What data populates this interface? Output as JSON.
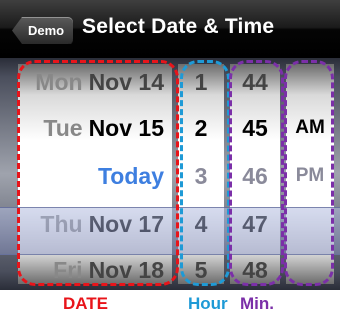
{
  "navbar": {
    "back_label": "Demo",
    "title": "Select Date & Time"
  },
  "picker": {
    "date": [
      {
        "dow": "Mon",
        "date": "Nov 14",
        "label": ""
      },
      {
        "dow": "Tue",
        "date": "Nov 15",
        "label": ""
      },
      {
        "dow": "",
        "date": "",
        "label": "Today"
      },
      {
        "dow": "Thu",
        "date": "Nov 17",
        "label": ""
      },
      {
        "dow": "Fri",
        "date": "Nov 18",
        "label": ""
      }
    ],
    "hour": [
      "1",
      "2",
      "3",
      "4",
      "5"
    ],
    "minute": [
      "44",
      "45",
      "46",
      "47",
      "48"
    ],
    "ampm": [
      "AM",
      "PM"
    ]
  },
  "captions": {
    "date": "DATE",
    "hour": "Hour",
    "min": "Min."
  },
  "colors": {
    "date": "#e8141a",
    "hour": "#1e9ad6",
    "min": "#7b2fa8",
    "today": "#3e7fe0"
  }
}
